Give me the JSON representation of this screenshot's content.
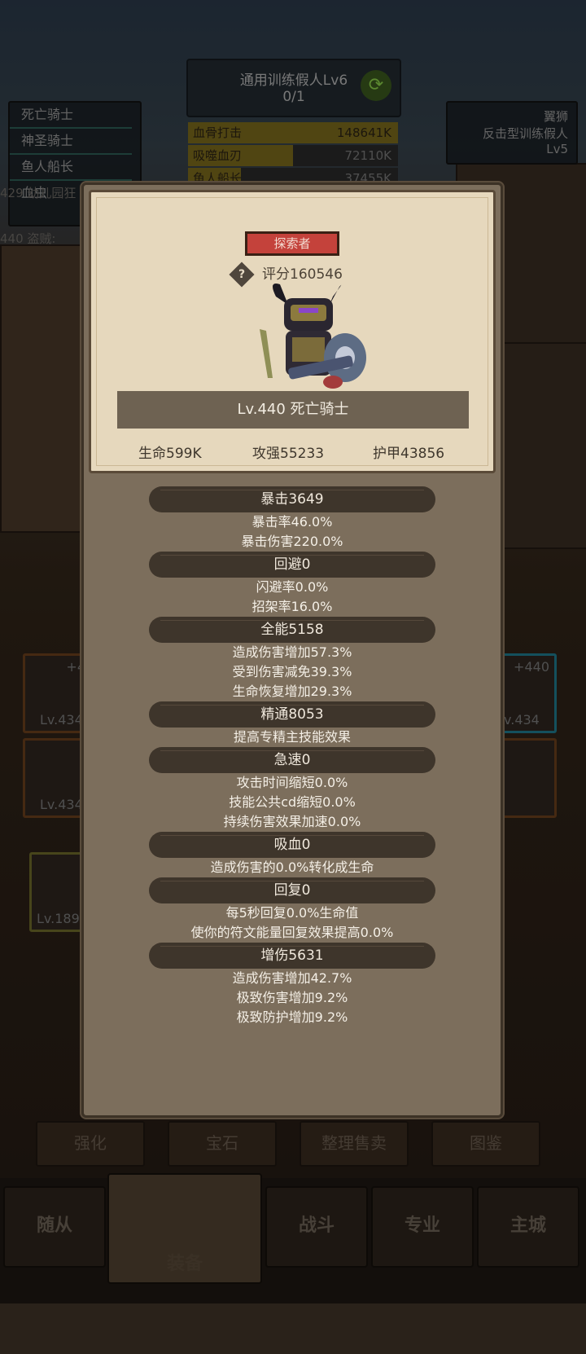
{
  "background": {
    "trainer": {
      "title": "通用训练假人Lv6",
      "progress": "0/1"
    },
    "left_list": [
      "死亡骑士",
      "神圣骑士",
      "鱼人船长",
      "血虫"
    ],
    "left_overlay_1": "429 幼儿园狂",
    "left_overlay_2": "440 盗贼:",
    "dps": [
      {
        "name": "血骨打击",
        "value": "148641K",
        "fill": 1.0
      },
      {
        "name": "吸噬血刃",
        "value": "72110K",
        "fill": 0.5
      },
      {
        "name": "鱼人船长",
        "value": "37455K",
        "fill": 0.25
      }
    ],
    "right_box": {
      "l1": "翼狮",
      "l2": "反击型训练假人",
      "l3": "Lv5"
    },
    "equip": [
      {
        "plus": "+4",
        "lv": "Lv.434"
      },
      {
        "plus": "",
        "lv": "Lv.434"
      },
      {
        "plus": "+440",
        "lv": "v.434"
      },
      {
        "plus": "",
        "lv": "Lv.189"
      }
    ],
    "bottom_buttons": [
      "强化",
      "宝石",
      "整理售卖",
      "图鉴"
    ],
    "nav": [
      "随从",
      "装备",
      "战斗",
      "专业",
      "主城"
    ]
  },
  "popup": {
    "badge": "探索者",
    "score_label": "评分160546",
    "hero_name": "Lv.440 死亡骑士",
    "hp": "生命599K",
    "attack": "攻强55233",
    "armor": "护甲43856",
    "groups": [
      {
        "title": "暴击3649",
        "lines": [
          "暴击率46.0%",
          "暴击伤害220.0%"
        ]
      },
      {
        "title": "回避0",
        "lines": [
          "闪避率0.0%",
          "招架率16.0%"
        ]
      },
      {
        "title": "全能5158",
        "lines": [
          "造成伤害增加57.3%",
          "受到伤害减免39.3%",
          "生命恢复增加29.3%"
        ]
      },
      {
        "title": "精通8053",
        "lines": [
          "提高专精主技能效果"
        ]
      },
      {
        "title": "急速0",
        "lines": [
          "攻击时间缩短0.0%",
          "技能公共cd缩短0.0%",
          "持续伤害效果加速0.0%"
        ]
      },
      {
        "title": "吸血0",
        "lines": [
          "造成伤害的0.0%转化成生命"
        ]
      },
      {
        "title": "回复0",
        "lines": [
          "每5秒回复0.0%生命值",
          "使你的符文能量回复效果提高0.0%"
        ]
      },
      {
        "title": "增伤5631",
        "lines": [
          "造成伤害增加42.7%",
          "极致伤害增加9.2%",
          "极致防护增加9.2%"
        ]
      }
    ]
  }
}
